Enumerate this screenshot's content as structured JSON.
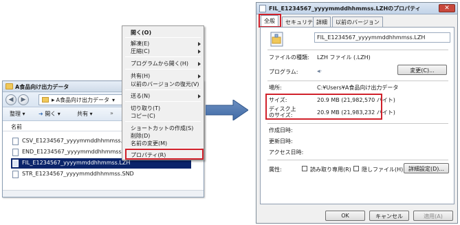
{
  "explorer": {
    "title": "A食品向け出力データ",
    "address": "A食品向け出力データ",
    "toolbar": {
      "organize": "整理",
      "open": "開く",
      "share": "共有"
    },
    "column_name": "名前",
    "files": [
      "CSV_E1234567_yyyymmddhhmmss.LZH",
      "END_E1234567_yyyymmddhhmmss.SND",
      "FIL_E1234567_yyyymmddhhmmss.LZH",
      "STR_E1234567_yyyymmddhhmmss.SND"
    ]
  },
  "context_menu": {
    "items": [
      "開く(O)",
      "解凍(E)",
      "圧縮(C)",
      "プログラムから開く(H)",
      "共有(H)",
      "以前のバージョンの復元(V)",
      "送る(N)",
      "切り取り(T)",
      "コピー(C)",
      "ショートカットの作成(S)",
      "削除(D)",
      "名前の変更(M)",
      "プロパティ(R)"
    ]
  },
  "dialog": {
    "title": "FIL_E1234567_yyyymmddhhmmss.LZHのプロパティ",
    "close": "✕",
    "tabs": [
      "全般",
      "セキュリティ",
      "詳細",
      "以前のバージョン"
    ],
    "file_name": "FIL_E1234567_yyyymmddhhmmss.LZH",
    "labels": {
      "type": "ファイルの種類:",
      "program": "プログラム:",
      "location": "場所:",
      "size": "サイズ:",
      "disk_size": "ディスク上\nのサイズ:",
      "created": "作成日時:",
      "modified": "更新日時:",
      "accessed": "アクセス日時:",
      "attributes": "属性:"
    },
    "values": {
      "type": "LZH ファイル (.LZH)",
      "location": "C:¥Users¥A食品向け出力データ",
      "size": "20.9 MB (21,982,570 バイト)",
      "disk_size": "20.9 MB (21,983,232 バイト)"
    },
    "buttons": {
      "change": "変更(C)...",
      "advanced": "詳細設定(D)...",
      "ok": "OK",
      "cancel": "キャンセル",
      "apply": "適用(A)"
    },
    "checkboxes": {
      "readonly": "読み取り専用(R)",
      "hidden": "隠しファイル(H)"
    }
  }
}
